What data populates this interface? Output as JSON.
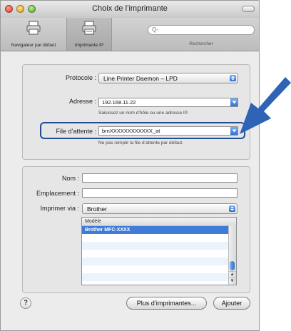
{
  "window": {
    "title": "Choix de l’imprimante"
  },
  "toolbar": {
    "default_label": "Navigateur par défaut",
    "ip_label": "Imprimante IP",
    "search_placeholder": "Q-",
    "search_label": "Rechercher"
  },
  "ip_form": {
    "protocol_label": "Protocole :",
    "protocol_value": "Line Printer Daemon – LPD",
    "address_label": "Adresse :",
    "address_value": "192.168.11.22",
    "address_hint": "Saisissez un nom d’hôte ou une adresse IP.",
    "queue_label": "File d’attente :",
    "queue_value": "brnXXXXXXXXXXXX_at",
    "queue_hint": "Ne pas remplir la file d’attente par défaut."
  },
  "details": {
    "name_label": "Nom :",
    "name_value": "",
    "location_label": "Emplacement :",
    "location_value": "",
    "print_via_label": "Imprimer via :",
    "print_via_value": "Brother",
    "model_header": "Modèle",
    "models": [
      "Brother MFC-XXXX",
      "",
      "",
      "",
      "",
      "",
      ""
    ]
  },
  "footer": {
    "help_glyph": "?",
    "more_printers_label": "Plus d’imprimantes...",
    "add_label": "Ajouter"
  },
  "colors": {
    "highlight": "#204e96",
    "arrow": "#2f63b5",
    "selection": "#3f7bd8"
  }
}
